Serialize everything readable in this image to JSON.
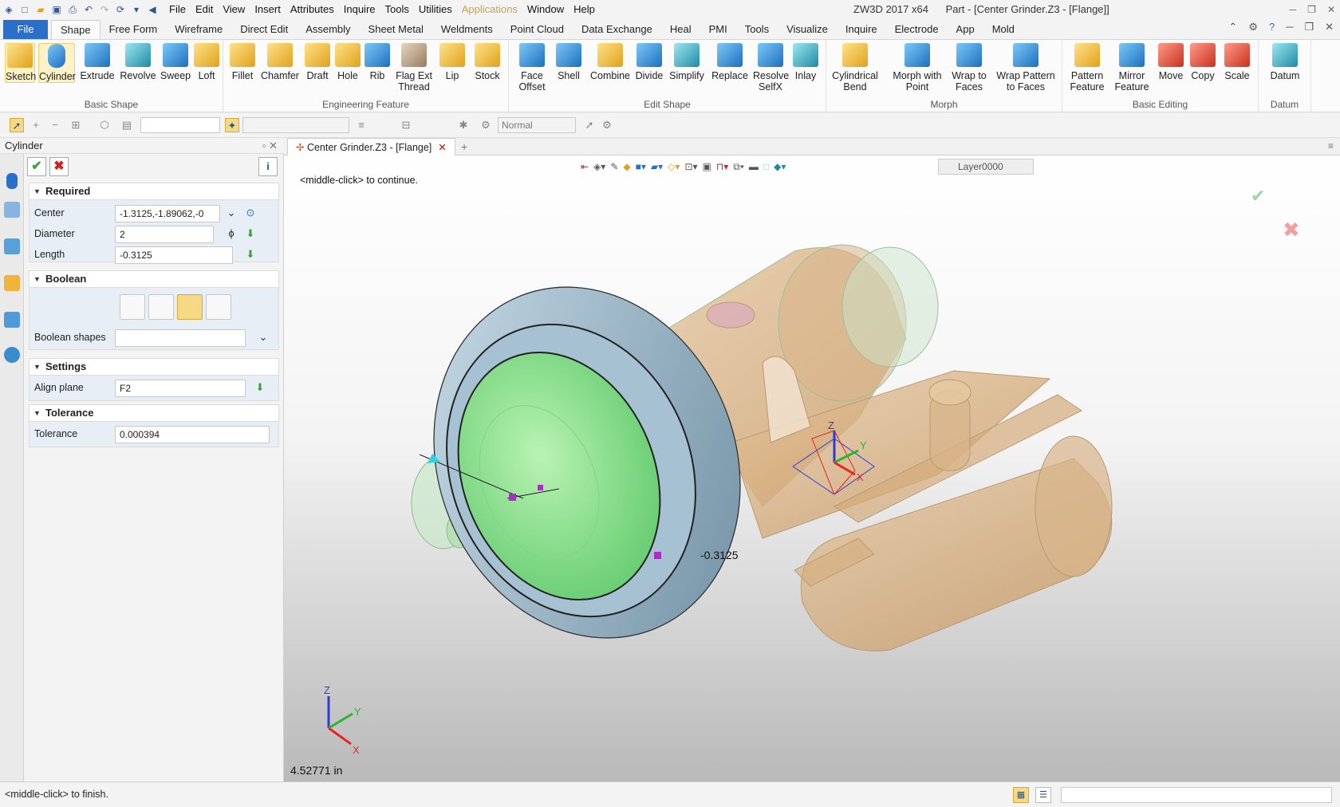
{
  "titlebar": {
    "menu": [
      "File",
      "Edit",
      "View",
      "Insert",
      "Attributes",
      "Inquire",
      "Tools",
      "Utilities",
      "Applications",
      "Window",
      "Help"
    ],
    "app_name": "ZW3D 2017  x64",
    "doc_title": "Part - [Center Grinder.Z3 - [Flange]]"
  },
  "ribbon_tabs": [
    "File",
    "Shape",
    "Free Form",
    "Wireframe",
    "Direct Edit",
    "Assembly",
    "Sheet Metal",
    "Weldments",
    "Point Cloud",
    "Data Exchange",
    "Heal",
    "PMI",
    "Tools",
    "Visualize",
    "Inquire",
    "Electrode",
    "App",
    "Mold"
  ],
  "active_tab": "Shape",
  "ribbon": {
    "basic_shape": {
      "label": "Basic Shape",
      "buttons": [
        "Sketch",
        "Cylinder",
        "Extrude",
        "Revolve",
        "Sweep",
        "Loft"
      ]
    },
    "engineering_feature": {
      "label": "Engineering Feature",
      "buttons": [
        "Fillet",
        "Chamfer",
        "Draft",
        "Hole",
        "Rib",
        "Flag Ext Thread",
        "Lip",
        "Stock"
      ]
    },
    "edit_shape": {
      "label": "Edit Shape",
      "buttons": [
        "Face Offset",
        "Shell",
        "Combine",
        "Divide",
        "Simplify",
        "Replace",
        "Resolve SelfX",
        "Inlay"
      ]
    },
    "morph": {
      "label": "Morph",
      "buttons": [
        "Cylindrical Bend",
        "Morph with Point",
        "Wrap to Faces",
        "Wrap Pattern to Faces"
      ]
    },
    "basic_editing": {
      "label": "Basic Editing",
      "buttons": [
        "Pattern Feature",
        "Mirror Feature",
        "Move",
        "Copy",
        "Scale"
      ]
    },
    "datum": {
      "label": "Datum",
      "buttons": [
        "Datum"
      ]
    }
  },
  "toolstrip": {
    "render_mode": "Normal"
  },
  "panel": {
    "title": "Cylinder",
    "required": {
      "label": "Required",
      "center": {
        "label": "Center",
        "value": "-1.3125,-1.89062,-0"
      },
      "diameter": {
        "label": "Diameter",
        "value": "2"
      },
      "length": {
        "label": "Length",
        "value": "-0.3125"
      }
    },
    "boolean": {
      "label": "Boolean",
      "shapes_label": "Boolean shapes",
      "shapes_value": ""
    },
    "settings": {
      "label": "Settings",
      "align_label": "Align plane",
      "align_value": "F2"
    },
    "tolerance": {
      "label": "Tolerance",
      "tol_label": "Tolerance",
      "tol_value": "0.000394"
    }
  },
  "doc_tab": "Center Grinder.Z3 - [Flange]",
  "viewport": {
    "prompt": "<middle-click> to continue.",
    "layer": "Layer0000",
    "dim_label": "-0.3125",
    "distance": "4.52771 in",
    "axes": {
      "x": "X",
      "y": "Y",
      "z": "Z"
    }
  },
  "status": {
    "message": "<middle-click> to finish."
  },
  "colors": {
    "file_tab": "#2a6fc9",
    "accent_sel": "#f6d985",
    "ok": "#39a23a",
    "cancel": "#d21f1f"
  }
}
